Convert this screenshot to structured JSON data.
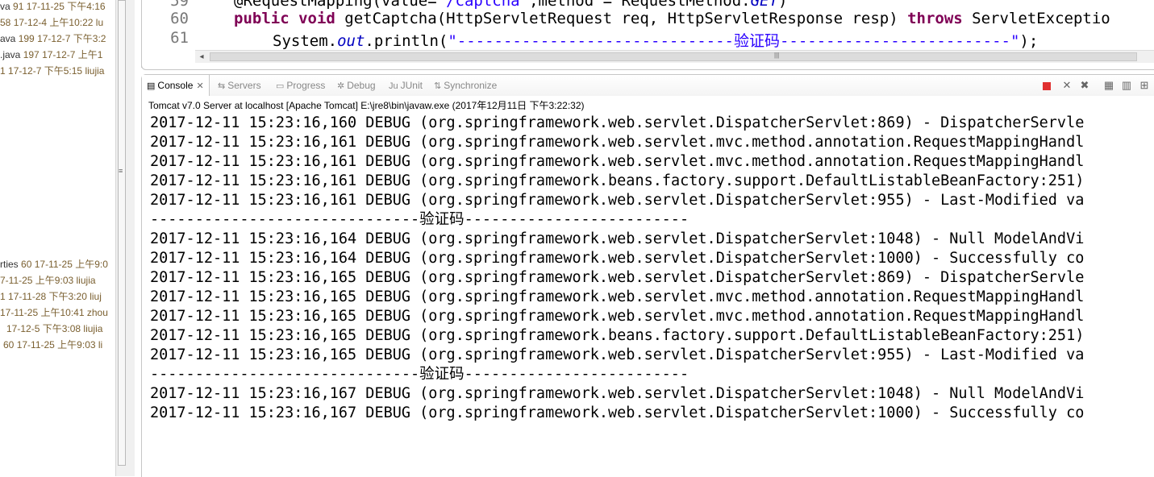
{
  "explorer": {
    "rows": [
      {
        "name": "va",
        "num": "91",
        "date": "17-11-25 下午4:16",
        "author": ""
      },
      {
        "name": "58",
        "num": "",
        "date": "17-12-4 上午10:22",
        "author": "lu"
      },
      {
        "name": "ava",
        "num": "199",
        "date": "17-12-7 下午3:2",
        "author": ""
      },
      {
        "name": ".java",
        "num": "197",
        "date": "17-12-7 上午1",
        "author": ""
      },
      {
        "name": "1",
        "num": "",
        "date": "17-12-7 下午5:15",
        "author": "liujia"
      },
      {
        "name": "rties",
        "num": "60",
        "date": "17-11-25 上午9:0",
        "author": ""
      },
      {
        "name": "7-11-25 上午9:03",
        "num": "",
        "date": "",
        "author": "liujia"
      },
      {
        "name": "1",
        "num": "",
        "date": "17-11-28 下午3:20",
        "author": "liuj"
      },
      {
        "name": "17-11-25 上午10:41",
        "num": "",
        "date": "",
        "author": "zhou"
      },
      {
        "name": "",
        "num": "",
        "date": "17-12-5 下午3:08",
        "author": "liujia"
      },
      {
        "name": "60",
        "num": "",
        "date": "17-11-25 上午9:03",
        "author": "li"
      }
    ]
  },
  "editor": {
    "line_numbers": [
      "59",
      "60",
      "61"
    ],
    "line59": {
      "annot": "@RequestMapping(value=",
      "str": "\"/captcha\"",
      "rest": ",method = RequestMethod.",
      "fld": "GET",
      "end": ")"
    },
    "line60": {
      "kw1": "public",
      "kw2": "void",
      "text1": " getCaptcha(HttpServletRequest req, HttpServletResponse resp) ",
      "kw3": "throws",
      "text2": " ServletExceptio"
    },
    "line61": {
      "text1": "System.",
      "fld": "out",
      "text2": ".println(",
      "str": "\"------------------------------验证码-------------------------\"",
      "end": ");"
    }
  },
  "console": {
    "tabs": [
      {
        "label": "Console",
        "icon": "console-icon"
      },
      {
        "label": "Servers",
        "icon": "servers-icon"
      },
      {
        "label": "Progress",
        "icon": "progress-icon"
      },
      {
        "label": "Debug",
        "icon": "debug-icon"
      },
      {
        "label": "JUnit",
        "icon": "junit-icon"
      },
      {
        "label": "Synchronize",
        "icon": "synchronize-icon"
      }
    ],
    "description": "Tomcat v7.0 Server at localhost [Apache Tomcat] E:\\jre8\\bin\\javaw.exe (2017年12月11日 下午3:22:32)",
    "lines": [
      "2017-12-11 15:23:16,160 DEBUG (org.springframework.web.servlet.DispatcherServlet:869) - DispatcherServle",
      "2017-12-11 15:23:16,161 DEBUG (org.springframework.web.servlet.mvc.method.annotation.RequestMappingHandl",
      "2017-12-11 15:23:16,161 DEBUG (org.springframework.web.servlet.mvc.method.annotation.RequestMappingHandl",
      "2017-12-11 15:23:16,161 DEBUG (org.springframework.beans.factory.support.DefaultListableBeanFactory:251)",
      "2017-12-11 15:23:16,161 DEBUG (org.springframework.web.servlet.DispatcherServlet:955) - Last-Modified va",
      "------------------------------验证码-------------------------",
      "2017-12-11 15:23:16,164 DEBUG (org.springframework.web.servlet.DispatcherServlet:1048) - Null ModelAndVi",
      "2017-12-11 15:23:16,164 DEBUG (org.springframework.web.servlet.DispatcherServlet:1000) - Successfully co",
      "2017-12-11 15:23:16,165 DEBUG (org.springframework.web.servlet.DispatcherServlet:869) - DispatcherServle",
      "2017-12-11 15:23:16,165 DEBUG (org.springframework.web.servlet.mvc.method.annotation.RequestMappingHandl",
      "2017-12-11 15:23:16,165 DEBUG (org.springframework.web.servlet.mvc.method.annotation.RequestMappingHandl",
      "2017-12-11 15:23:16,165 DEBUG (org.springframework.beans.factory.support.DefaultListableBeanFactory:251)",
      "2017-12-11 15:23:16,165 DEBUG (org.springframework.web.servlet.DispatcherServlet:955) - Last-Modified va",
      "------------------------------验证码-------------------------",
      "2017-12-11 15:23:16,167 DEBUG (org.springframework.web.servlet.DispatcherServlet:1048) - Null ModelAndVi",
      "2017-12-11 15:23:16,167 DEBUG (org.springframework.web.servlet.DispatcherServlet:1000) - Successfully co"
    ]
  },
  "colors": {
    "keyword": "#7f0055",
    "string": "#2a00ff",
    "field": "#0000c0",
    "terminate": "#e03030"
  }
}
